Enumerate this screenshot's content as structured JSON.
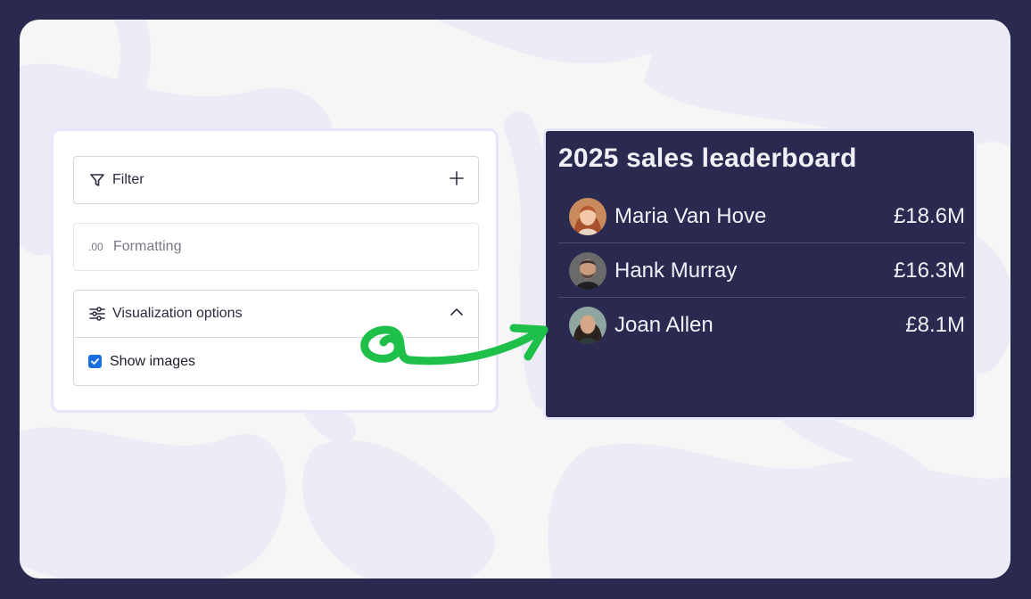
{
  "sidebar": {
    "filter": {
      "label": "Filter",
      "icon": "filter-icon",
      "action_icon": "plus-icon"
    },
    "formatting": {
      "label": "Formatting",
      "prefix": ".00"
    },
    "visualization": {
      "label": "Visualization options",
      "icon": "sliders-icon",
      "toggle_icon": "chevron-up-icon",
      "show_images": {
        "label": "Show images",
        "checked": true
      }
    }
  },
  "leaderboard": {
    "title": "2025 sales leaderboard",
    "rows": [
      {
        "name": "Maria Van Hove",
        "value": "£18.6M"
      },
      {
        "name": "Hank Murray",
        "value": "£16.3M"
      },
      {
        "name": "Joan Allen",
        "value": "£8.1M"
      }
    ]
  },
  "colors": {
    "background": "#2a2950",
    "card": "#2a2950",
    "checkbox": "#1a6fe0",
    "arrow": "#1fc04a"
  }
}
